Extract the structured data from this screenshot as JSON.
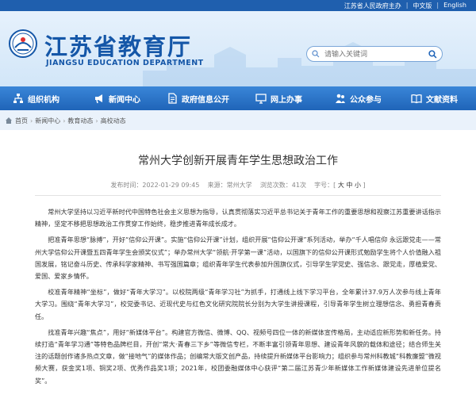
{
  "topbar": {
    "sponsor": "江苏省人民政府主办",
    "lang_cn": "中文版",
    "lang_en": "English"
  },
  "header": {
    "title_cn": "江苏省教育厅",
    "title_en": "JIANGSU EDUCATION DEPARTMENT",
    "search_placeholder": "请输入关键词"
  },
  "nav": {
    "items": [
      {
        "label": "组织机构",
        "icon": "org-icon"
      },
      {
        "label": "新闻中心",
        "icon": "megaphone-icon"
      },
      {
        "label": "政府信息公开",
        "icon": "document-icon"
      },
      {
        "label": "网上办事",
        "icon": "monitor-icon"
      },
      {
        "label": "公众参与",
        "icon": "people-icon"
      },
      {
        "label": "文献资料",
        "icon": "book-icon"
      }
    ]
  },
  "breadcrumb": {
    "items": [
      "首页",
      "新闻中心",
      "教育动态",
      "高校动态"
    ]
  },
  "article": {
    "title": "常州大学创新开展青年学生思想政治工作",
    "date": "发布时间：2022-01-29 09:45",
    "source": "来源：常州大学",
    "views": "浏览次数：41次",
    "font_label": "字号：",
    "font_large": "大",
    "font_mid": "中",
    "font_small": "小",
    "paragraphs": [
      "常州大学坚持以习近平新时代中国特色社会主义思想为指导，认真贯彻落实习近平总书记关于青年工作的重要思想和视察江苏重要讲话指示精神，坚定不移把思想政治工作贯穿工作始终，稳步推进青年成长成才。",
      "把准青年思想“脉搏”，开好“信仰公开课”。实施“信仰公开课”计划，组织开展“信仰公开课”系列活动，举办“千人唱信仰 永远跟党走——常州大学信仰公开课暨五四青年学生会颁奖仪式”；举办常州大学“领航·开学第一课”活动，以国旗下的信仰公开课形式勉励学生将个人价值融入祖国发展，铭记奋斗历史、传承科学家精神、书写强国篇章；组织青年学生代表参加升国旗仪式，引导学生学党史、强信念、跟党走，厚植爱党、爱国、爱家乡情怀。",
      "校准青年精神“坐标”，做好“青年大学习”。以校院两级“青年学习社”为抓手，打通线上线下学习平台，全年累计37.9万人次参与线上青年大学习。围绕“青年大学习”，校党委书记、近现代史与红色文化研究院院长分别为大学生讲授课程，引导青年学生树立理想信念、勇担青春责任。",
      "找准青年兴趣“焦点”，用好“新媒体平台”。构建官方微信、微博、QQ、视频号四位一体的新媒体宣传格局，主动适应新形势和新任务。持续打造“青年学习通”等特色品牌栏目，开创“常大·青春三下乡”等微信专栏，不断丰富引领青年思想、建设青年风貌的载体和途径；结合师生关注的话题创作诸多热点文章，做“接地气”的媒体作品；创编常大版文创产品，持续提升新媒体平台影响力；组织参与常州科教城“科教廉盟”微视频大赛，获金奖1项、铜奖2项、优秀作品奖1项；2021年，校团委融媒体中心获评“第二届江苏青少年新媒体工作新媒体建设先进单位提名奖”。"
    ]
  }
}
